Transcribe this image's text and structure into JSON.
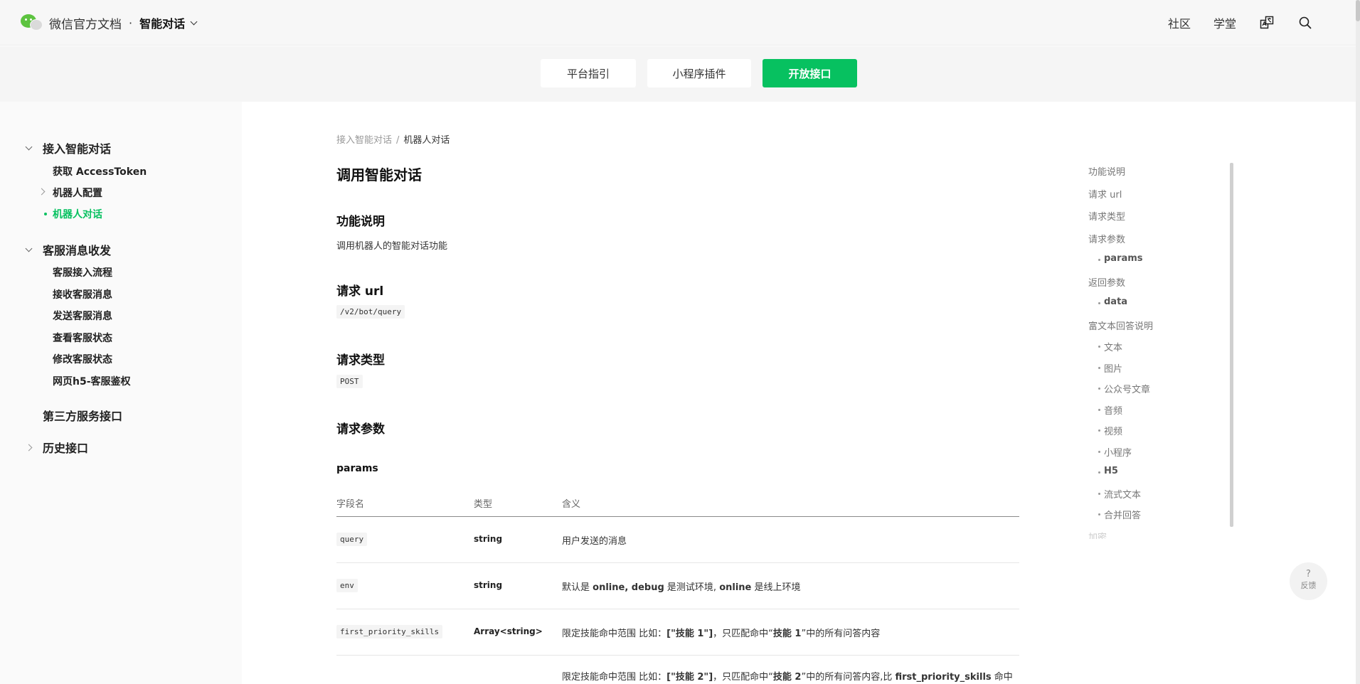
{
  "header": {
    "brand": "微信官方文档",
    "dot": "·",
    "section": "智能对话",
    "nav": [
      "社区",
      "学堂"
    ],
    "icons": [
      "translate-icon",
      "search-icon"
    ]
  },
  "tabs": [
    "平台指引",
    "小程序插件",
    "开放接口"
  ],
  "tab_active": "开放接口",
  "sidebar": {
    "group1": "接入智能对话",
    "group1_items": [
      "获取 AccessToken",
      "机器人配置",
      "机器人对话"
    ],
    "group2": "客服消息收发",
    "group2_items": [
      "客服接入流程",
      "接收客服消息",
      "发送客服消息",
      "查看客服状态",
      "修改客服状态",
      "网页h5-客服鉴权"
    ],
    "group3": "第三方服务接口",
    "group4": "历史接口"
  },
  "breadcrumb": {
    "parent": "接入智能对话",
    "sep": "/",
    "current": "机器人对话"
  },
  "content": {
    "title": "调用智能对话",
    "s1_title": "功能说明",
    "s1_text": "调用机器人的智能对话功能",
    "s2_title": "请求 url",
    "s2_code": "/v2/bot/query",
    "s3_title": "请求类型",
    "s3_code": "POST",
    "s4_title": "请求参数",
    "params_title": "params"
  },
  "table": {
    "headers": [
      "字段名",
      "类型",
      "含义"
    ],
    "rows": [
      {
        "name": "query",
        "type": "string",
        "desc": "用户发送的消息"
      },
      {
        "name": "env",
        "type": "string",
        "desc_parts": [
          "默认是 ",
          "online",
          ", ",
          "debug",
          " 是测试环境, ",
          "online",
          " 是线上环境"
        ]
      },
      {
        "name": "first_priority_skills",
        "type": "Array<string>",
        "desc_parts": [
          "限定技能命中范围 比如：",
          "[\"技能 1\"]",
          "，只匹配命中“",
          "技能 1",
          "”中的所有问答内容"
        ]
      },
      {
        "name": "",
        "type": "",
        "desc_parts": [
          "限定技能命中范围 比如：",
          "[\"技能 2\"]",
          "，只匹配命中“",
          "技能 2",
          "”中的所有问答内容,比 ",
          "first_priority_skills",
          " 命中"
        ]
      }
    ]
  },
  "toc": [
    "功能说明",
    "请求 url",
    "请求类型",
    "请求参数",
    "params",
    "返回参数",
    "data",
    "富文本回答说明",
    "文本",
    "图片",
    "公众号文章",
    "音频",
    "视频",
    "小程序",
    "H5",
    "流式文本",
    "合并回答",
    "加密"
  ],
  "feedback": {
    "symbol": "?",
    "label": "反馈"
  },
  "colors": {
    "accent": "#07c160"
  }
}
